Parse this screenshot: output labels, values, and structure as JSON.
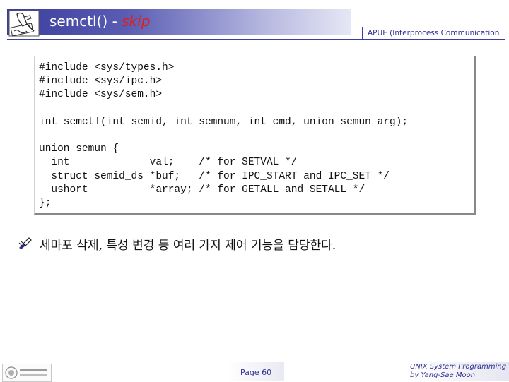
{
  "header": {
    "title_main": "semctl() - ",
    "title_accent": "skip",
    "course_label": "APUE (Interprocess Communication"
  },
  "code": {
    "lines": [
      "#include <sys/types.h>",
      "#include <sys/ipc.h>",
      "#include <sys/sem.h>",
      "",
      "int semctl(int semid, int semnum, int cmd, union semun arg);",
      "",
      "union semun {",
      "  int             val;    /* for SETVAL */",
      "  struct semid_ds *buf;   /* for IPC_START and IPC_SET */",
      "  ushort          *array; /* for GETALL and SETALL */",
      "};"
    ]
  },
  "bullet": {
    "icon": "pen-bullet-icon",
    "text": "세마포 삭제, 특성 변경 등 여러 가지 제어 기능을 담당한다."
  },
  "footer": {
    "page_label": "Page 60",
    "credit_line1": "UNIX System Programming",
    "credit_line2": "by Yang-Sae Moon",
    "logo_icon": "university-logo-icon"
  },
  "colors": {
    "title_bar": "#3a3d9c",
    "accent": "#e21b1b",
    "footer_text": "#2f3191"
  }
}
